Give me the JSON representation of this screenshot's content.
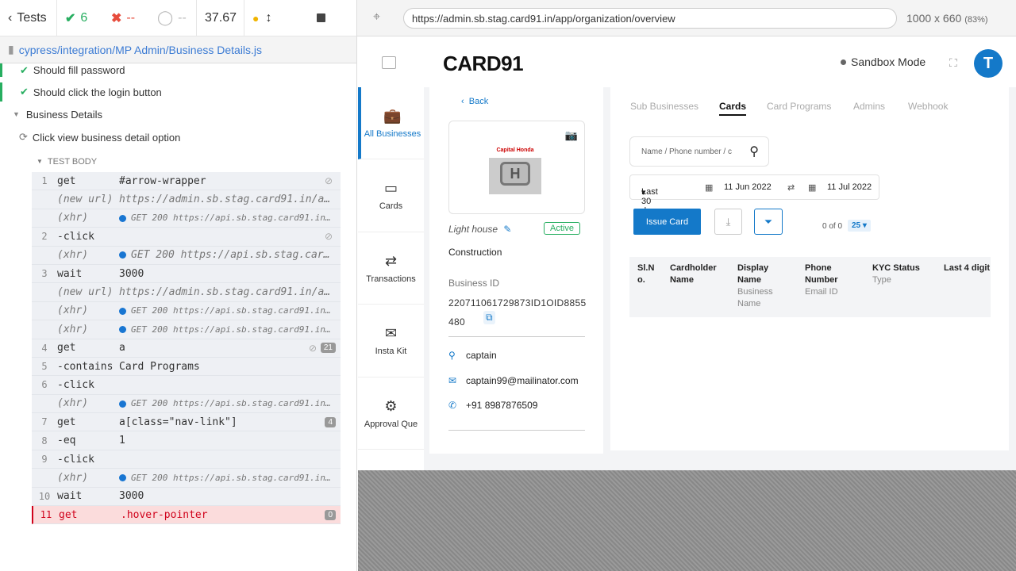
{
  "reporter": {
    "tests_label": "Tests",
    "passed": "6",
    "failed": "--",
    "pending": "--",
    "duration": "37.67",
    "spec_path": "cypress/integration/MP Admin/Business Details.js",
    "tests": [
      {
        "label": "Should fill password"
      },
      {
        "label": "Should click the login button"
      }
    ],
    "suite": "Business Details",
    "running_test": "Click view business detail option",
    "test_body_label": "TEST BODY",
    "commands": [
      {
        "num": "1",
        "name": "get",
        "msg": "#arrow-wrapper",
        "kind": "normal",
        "eye": true
      },
      {
        "num": "",
        "name": "(new url)",
        "msg": "https://admin.sb.stag.card91.in/app/...",
        "kind": "italic"
      },
      {
        "num": "",
        "name": "(xhr)",
        "msg": "GET 200 https://api.sb.stag.card91.in/is...",
        "kind": "xhr-small"
      },
      {
        "num": "2",
        "name": "-click",
        "msg": "",
        "kind": "normal",
        "eye": true
      },
      {
        "num": "",
        "name": "(xhr)",
        "msg": "GET 200 https://api.sb.stag.card9...",
        "kind": "xhr"
      },
      {
        "num": "3",
        "name": "wait",
        "msg": "3000",
        "kind": "normal"
      },
      {
        "num": "",
        "name": "(new url)",
        "msg": "https://admin.sb.stag.card91.in/app/...",
        "kind": "italic"
      },
      {
        "num": "",
        "name": "(xhr)",
        "msg": "GET 200 https://api.sb.stag.card91.in/is...",
        "kind": "xhr-small"
      },
      {
        "num": "",
        "name": "(xhr)",
        "msg": "GET 200 https://api.sb.stag.card91.in/is...",
        "kind": "xhr-small"
      },
      {
        "num": "4",
        "name": "get",
        "msg": "a",
        "kind": "normal",
        "eye": true,
        "badge": "21"
      },
      {
        "num": "5",
        "name": "-contains",
        "msg": "Card Programs",
        "kind": "normal"
      },
      {
        "num": "6",
        "name": "-click",
        "msg": "",
        "kind": "normal"
      },
      {
        "num": "",
        "name": "(xhr)",
        "msg": "GET 200 https://api.sb.stag.card91.in/is...",
        "kind": "xhr-small"
      },
      {
        "num": "7",
        "name": "get",
        "msg": "a[class=\"nav-link\"]",
        "kind": "normal",
        "badge": "4"
      },
      {
        "num": "8",
        "name": "-eq",
        "msg": "1",
        "kind": "normal"
      },
      {
        "num": "9",
        "name": "-click",
        "msg": "",
        "kind": "normal"
      },
      {
        "num": "",
        "name": "(xhr)",
        "msg": "GET 200 https://api.sb.stag.card91.in/is...",
        "kind": "xhr-small"
      },
      {
        "num": "10",
        "name": "wait",
        "msg": "3000",
        "kind": "normal"
      },
      {
        "num": "11",
        "name": "get",
        "msg": ".hover-pointer",
        "kind": "fail",
        "badge": "0"
      }
    ]
  },
  "browser": {
    "url": "https://admin.sb.stag.card91.in/app/organization/overview",
    "viewport": "1000 x 660",
    "scale": "(83%)"
  },
  "app": {
    "logo": "CARD91",
    "mode": "Sandbox Mode",
    "avatar_letter": "T",
    "nav": [
      {
        "label": "All Businesses",
        "icon": "briefcase-icon",
        "glyph": "💼"
      },
      {
        "label": "Cards",
        "icon": "card-icon",
        "glyph": "▭"
      },
      {
        "label": "Transactions",
        "icon": "transactions-icon",
        "glyph": "⇄"
      },
      {
        "label": "Insta Kit",
        "icon": "insta-kit-icon",
        "glyph": "✉"
      },
      {
        "label": "Approval Que",
        "icon": "approval-icon",
        "glyph": "⚙"
      }
    ],
    "detail": {
      "back_label": "Back",
      "logo_text": "Capital Honda",
      "logo_mark": "H",
      "business_name": "Light house",
      "status": "Active",
      "category": "Construction",
      "business_id_label": "Business ID",
      "business_id": "220711061729873ID1OID8855480",
      "contact_name": "captain",
      "email": "captain99@mailinator.com",
      "phone": "+91 8987876509"
    },
    "tabs": [
      "Sub Businesses",
      "Cards",
      "Card Programs",
      "Admins",
      "Webhook"
    ],
    "active_tab": "Cards",
    "search_placeholder": "Name / Phone number / c",
    "date_range": {
      "preset": "Last 30 days",
      "from": "11 Jun 2022",
      "to": "11 Jul 2022"
    },
    "issue_card_label": "Issue Card",
    "pager": "0 of 0",
    "page_size": "25",
    "table_headers": [
      {
        "title": "Sl.N o.",
        "sub": ""
      },
      {
        "title": "Cardholder Name",
        "sub": ""
      },
      {
        "title": "Display Name",
        "sub": "Business Name"
      },
      {
        "title": "Phone Number",
        "sub": "Email ID"
      },
      {
        "title": "KYC Status",
        "sub": "Type"
      },
      {
        "title": "Last 4 digit",
        "sub": ""
      }
    ]
  }
}
